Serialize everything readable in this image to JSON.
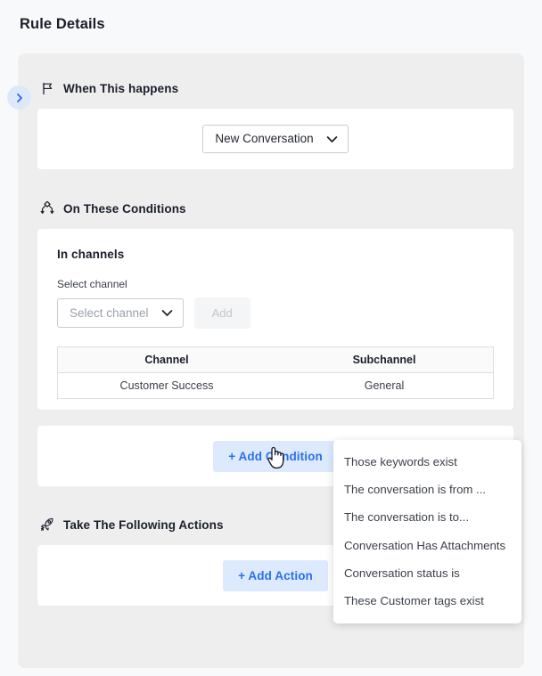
{
  "page": {
    "title": "Rule Details",
    "background_color": "#f8f9fb",
    "panel_color": "#eeeeee"
  },
  "collapse_toggle": {
    "icon": "chevron-right-icon",
    "color": "#2a6ff0",
    "background": "#dce9fb"
  },
  "sections": {
    "when": {
      "icon": "flag-icon",
      "label": "When This happens",
      "trigger_select": {
        "value": "New Conversation",
        "chevron_icon": "chevron-down-icon"
      }
    },
    "conditions": {
      "icon": "branch-nodes-icon",
      "label": "On These Conditions",
      "channels_card": {
        "heading": "In channels",
        "field_label": "Select channel",
        "select_placeholder": "Select channel",
        "select_chevron_icon": "chevron-down-icon",
        "add_button_label": "Add",
        "add_button_disabled": true,
        "table": {
          "columns": [
            "Channel",
            "Subchannel"
          ],
          "rows": [
            [
              "Customer Success",
              "General"
            ]
          ]
        }
      },
      "add_condition_button": {
        "label": "+ Add Condition",
        "text_color": "#2a6ff0",
        "background": "#ddeafe"
      }
    },
    "actions": {
      "icon": "rocket-icon",
      "label": "Take The Following Actions",
      "add_action_button": {
        "label": "+ Add Action",
        "text_color": "#2a6ff0",
        "background": "#ddeafe"
      }
    }
  },
  "condition_menu": {
    "open": true,
    "items": [
      "Those keywords exist",
      "The conversation is from ...",
      "The conversation is to...",
      "Conversation Has Attachments",
      "Conversation status is",
      "These Customer tags exist"
    ]
  },
  "cursor": {
    "type": "pointing-hand"
  }
}
